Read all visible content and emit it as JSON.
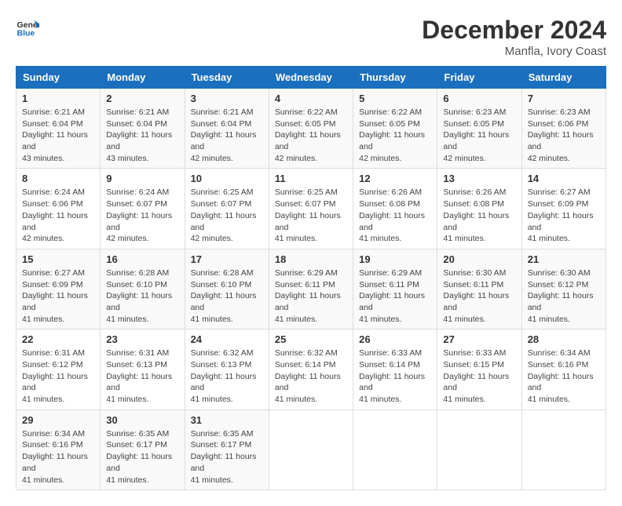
{
  "logo": {
    "text_general": "General",
    "text_blue": "Blue"
  },
  "title": {
    "month_year": "December 2024",
    "location": "Manfla, Ivory Coast"
  },
  "headers": [
    "Sunday",
    "Monday",
    "Tuesday",
    "Wednesday",
    "Thursday",
    "Friday",
    "Saturday"
  ],
  "weeks": [
    [
      {
        "day": "1",
        "sunrise": "6:21 AM",
        "sunset": "6:04 PM",
        "daylight": "11 hours and 43 minutes."
      },
      {
        "day": "2",
        "sunrise": "6:21 AM",
        "sunset": "6:04 PM",
        "daylight": "11 hours and 43 minutes."
      },
      {
        "day": "3",
        "sunrise": "6:21 AM",
        "sunset": "6:04 PM",
        "daylight": "11 hours and 42 minutes."
      },
      {
        "day": "4",
        "sunrise": "6:22 AM",
        "sunset": "6:05 PM",
        "daylight": "11 hours and 42 minutes."
      },
      {
        "day": "5",
        "sunrise": "6:22 AM",
        "sunset": "6:05 PM",
        "daylight": "11 hours and 42 minutes."
      },
      {
        "day": "6",
        "sunrise": "6:23 AM",
        "sunset": "6:05 PM",
        "daylight": "11 hours and 42 minutes."
      },
      {
        "day": "7",
        "sunrise": "6:23 AM",
        "sunset": "6:06 PM",
        "daylight": "11 hours and 42 minutes."
      }
    ],
    [
      {
        "day": "8",
        "sunrise": "6:24 AM",
        "sunset": "6:06 PM",
        "daylight": "11 hours and 42 minutes."
      },
      {
        "day": "9",
        "sunrise": "6:24 AM",
        "sunset": "6:07 PM",
        "daylight": "11 hours and 42 minutes."
      },
      {
        "day": "10",
        "sunrise": "6:25 AM",
        "sunset": "6:07 PM",
        "daylight": "11 hours and 42 minutes."
      },
      {
        "day": "11",
        "sunrise": "6:25 AM",
        "sunset": "6:07 PM",
        "daylight": "11 hours and 41 minutes."
      },
      {
        "day": "12",
        "sunrise": "6:26 AM",
        "sunset": "6:08 PM",
        "daylight": "11 hours and 41 minutes."
      },
      {
        "day": "13",
        "sunrise": "6:26 AM",
        "sunset": "6:08 PM",
        "daylight": "11 hours and 41 minutes."
      },
      {
        "day": "14",
        "sunrise": "6:27 AM",
        "sunset": "6:09 PM",
        "daylight": "11 hours and 41 minutes."
      }
    ],
    [
      {
        "day": "15",
        "sunrise": "6:27 AM",
        "sunset": "6:09 PM",
        "daylight": "11 hours and 41 minutes."
      },
      {
        "day": "16",
        "sunrise": "6:28 AM",
        "sunset": "6:10 PM",
        "daylight": "11 hours and 41 minutes."
      },
      {
        "day": "17",
        "sunrise": "6:28 AM",
        "sunset": "6:10 PM",
        "daylight": "11 hours and 41 minutes."
      },
      {
        "day": "18",
        "sunrise": "6:29 AM",
        "sunset": "6:11 PM",
        "daylight": "11 hours and 41 minutes."
      },
      {
        "day": "19",
        "sunrise": "6:29 AM",
        "sunset": "6:11 PM",
        "daylight": "11 hours and 41 minutes."
      },
      {
        "day": "20",
        "sunrise": "6:30 AM",
        "sunset": "6:11 PM",
        "daylight": "11 hours and 41 minutes."
      },
      {
        "day": "21",
        "sunrise": "6:30 AM",
        "sunset": "6:12 PM",
        "daylight": "11 hours and 41 minutes."
      }
    ],
    [
      {
        "day": "22",
        "sunrise": "6:31 AM",
        "sunset": "6:12 PM",
        "daylight": "11 hours and 41 minutes."
      },
      {
        "day": "23",
        "sunrise": "6:31 AM",
        "sunset": "6:13 PM",
        "daylight": "11 hours and 41 minutes."
      },
      {
        "day": "24",
        "sunrise": "6:32 AM",
        "sunset": "6:13 PM",
        "daylight": "11 hours and 41 minutes."
      },
      {
        "day": "25",
        "sunrise": "6:32 AM",
        "sunset": "6:14 PM",
        "daylight": "11 hours and 41 minutes."
      },
      {
        "day": "26",
        "sunrise": "6:33 AM",
        "sunset": "6:14 PM",
        "daylight": "11 hours and 41 minutes."
      },
      {
        "day": "27",
        "sunrise": "6:33 AM",
        "sunset": "6:15 PM",
        "daylight": "11 hours and 41 minutes."
      },
      {
        "day": "28",
        "sunrise": "6:34 AM",
        "sunset": "6:16 PM",
        "daylight": "11 hours and 41 minutes."
      }
    ],
    [
      {
        "day": "29",
        "sunrise": "6:34 AM",
        "sunset": "6:16 PM",
        "daylight": "11 hours and 41 minutes."
      },
      {
        "day": "30",
        "sunrise": "6:35 AM",
        "sunset": "6:17 PM",
        "daylight": "11 hours and 41 minutes."
      },
      {
        "day": "31",
        "sunrise": "6:35 AM",
        "sunset": "6:17 PM",
        "daylight": "11 hours and 41 minutes."
      },
      null,
      null,
      null,
      null
    ]
  ]
}
